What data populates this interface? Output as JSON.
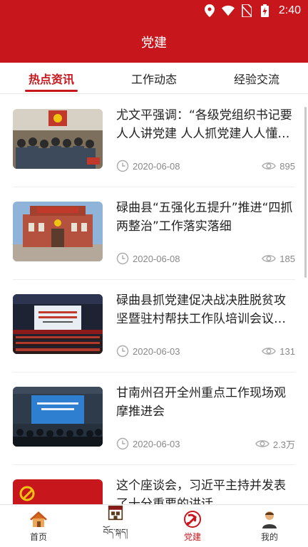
{
  "status": {
    "time": "2:40"
  },
  "header": {
    "title": "党建"
  },
  "tabs": [
    {
      "label": "热点资讯",
      "active": true
    },
    {
      "label": "工作动态",
      "active": false
    },
    {
      "label": "经验交流",
      "active": false
    }
  ],
  "articles": [
    {
      "title": "尤文平强调：“各级党组织书记要人人讲党建 人人抓党建人人懂党建”",
      "date": "2020-06-08",
      "views": "895",
      "thumb": "meeting-photo"
    },
    {
      "title": "碌曲县“五强化五提升”推进“四抓两整治”工作落实落细",
      "date": "2020-06-08",
      "views": "185",
      "thumb": "building-photo"
    },
    {
      "title": "碌曲县抓党建促决战决胜脱贫攻坚暨驻村帮扶工作队培训会议召开",
      "date": "2020-06-03",
      "views": "131",
      "thumb": "auditorium-photo"
    },
    {
      "title": "甘南州召开全州重点工作现场观摩推进会",
      "date": "2020-06-03",
      "views": "2.3万",
      "thumb": "conference-photo"
    },
    {
      "title": "这个座谈会，习近平主持并发表了十分重要的讲话",
      "date": "",
      "views": "",
      "thumb": "party-flag-photo"
    }
  ],
  "bottom_nav": [
    {
      "label": "首页",
      "icon": "home-icon",
      "active": false
    },
    {
      "label": "བོད་སྐད།",
      "icon": "tibetan-house-icon",
      "active": false
    },
    {
      "label": "党建",
      "icon": "party-emblem-icon",
      "active": true
    },
    {
      "label": "我的",
      "icon": "profile-icon",
      "active": false
    }
  ],
  "colors": {
    "brand": "#c8161d",
    "meta_text": "#888888"
  }
}
